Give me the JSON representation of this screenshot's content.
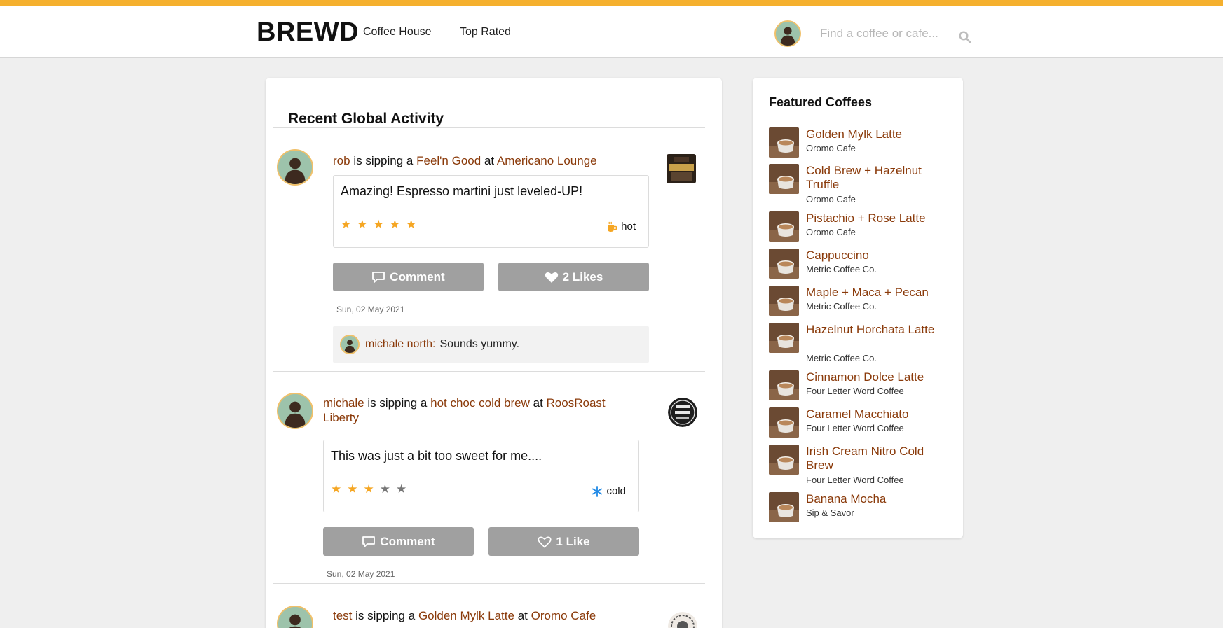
{
  "colors": {
    "accent": "#f5b02e",
    "link": "#8a3a0a",
    "star": "#f5a623",
    "button": "#a0a0a0",
    "cold": "#1e88e5"
  },
  "header": {
    "logo": "BREWD",
    "nav": [
      {
        "label": "Coffee House"
      },
      {
        "label": "Top Rated"
      }
    ],
    "search_placeholder": "Find a coffee or cafe...",
    "search_icon": "search-icon"
  },
  "feed": {
    "title": "Recent Global Activity",
    "items": [
      {
        "user": "rob",
        "verb": "is sipping a",
        "coffee": "Feel'n Good",
        "at": "at",
        "cafe": "Americano Lounge",
        "review": "Amazing! Espresso martini just leveled-UP!",
        "rating": 5,
        "temp": "hot",
        "temp_icon": "hot-cup-icon",
        "comment_label": "Comment",
        "likes_label": "2 Likes",
        "liked": true,
        "date": "Sun, 02 May 2021",
        "comments": [
          {
            "author": "michale north:",
            "text": "Sounds yummy."
          }
        ]
      },
      {
        "user": "michale",
        "verb": "is sipping a",
        "coffee": "hot choc cold brew",
        "at": "at",
        "cafe": "RoosRoast Liberty",
        "review": "This was just a bit too sweet for me....",
        "rating": 3,
        "temp": "cold",
        "temp_icon": "snowflake-icon",
        "comment_label": "Comment",
        "likes_label": "1 Like",
        "liked": false,
        "date": "Sun, 02 May 2021",
        "comments": []
      },
      {
        "user": "test",
        "verb": "is sipping a",
        "coffee": "Golden Mylk Latte",
        "at": "at",
        "cafe": "Oromo Cafe"
      }
    ]
  },
  "featured": {
    "title": "Featured Coffees",
    "items": [
      {
        "name": "Golden Mylk Latte",
        "cafe": "Oromo Cafe"
      },
      {
        "name": "Cold Brew + Hazelnut Truffle",
        "cafe": "Oromo Cafe"
      },
      {
        "name": "Pistachio + Rose Latte",
        "cafe": "Oromo Cafe"
      },
      {
        "name": "Cappuccino",
        "cafe": "Metric Coffee Co."
      },
      {
        "name": "Maple + Maca + Pecan",
        "cafe": "Metric Coffee Co."
      },
      {
        "name": "Hazelnut Horchata Latte",
        "cafe": "Metric Coffee Co."
      },
      {
        "name": "Cinnamon Dolce Latte",
        "cafe": "Four Letter Word Coffee"
      },
      {
        "name": "Caramel Macchiato",
        "cafe": "Four Letter Word Coffee"
      },
      {
        "name": "Irish Cream Nitro Cold Brew",
        "cafe": "Four Letter Word Coffee"
      },
      {
        "name": "Banana Mocha",
        "cafe": "Sip & Savor"
      }
    ]
  }
}
